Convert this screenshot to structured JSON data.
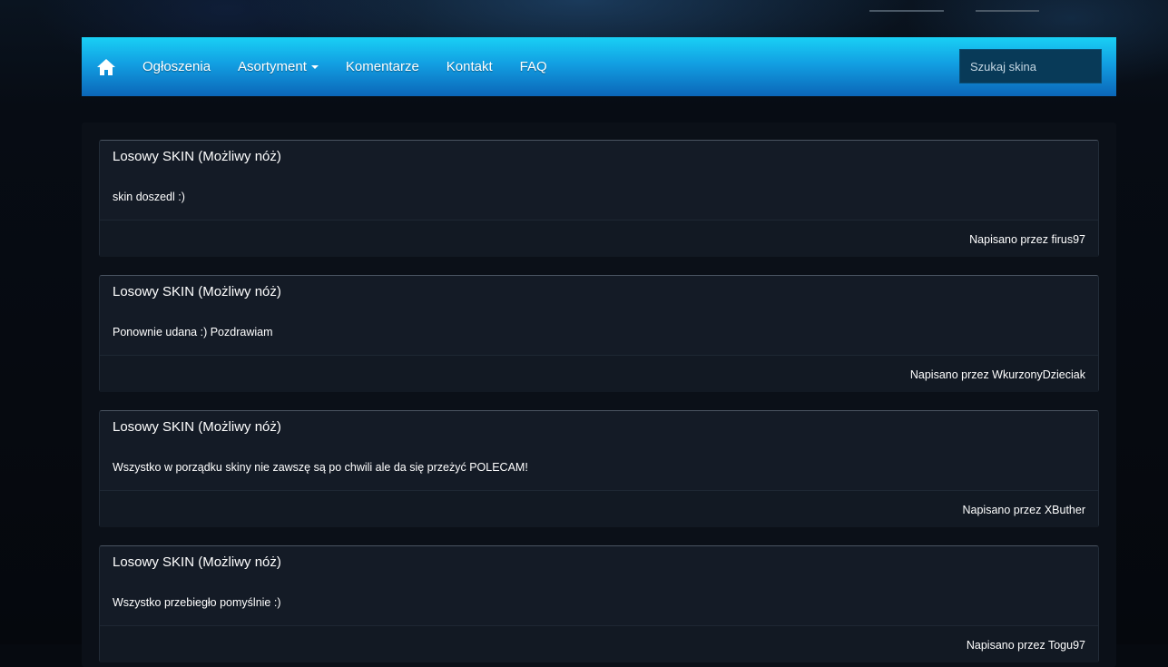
{
  "nav": {
    "home_icon": "home-icon",
    "links": {
      "announcements": "Ogłoszenia",
      "assortment": "Asortyment",
      "comments": "Komentarze",
      "contact": "Kontakt",
      "faq": "FAQ"
    },
    "search_placeholder": "Szukaj skina"
  },
  "colors": {
    "navbar_top": "#19d0f5",
    "navbar_bottom": "#0b66b8",
    "card_bg": "#141b26",
    "page_bg": "#060a10"
  },
  "comments": [
    {
      "title": "Losowy SKIN (Możliwy nóż)",
      "body": "skin doszedl :)",
      "author": "Napisano przez firus97"
    },
    {
      "title": "Losowy SKIN (Możliwy nóż)",
      "body": "Ponownie udana :) Pozdrawiam",
      "author": "Napisano przez WkurzonyDzieciak"
    },
    {
      "title": "Losowy SKIN (Możliwy nóż)",
      "body": "Wszystko w porządku skiny nie zawszę są po chwili ale da się przeżyć POLECAM!",
      "author": "Napisano przez XButher"
    },
    {
      "title": "Losowy SKIN (Możliwy nóż)",
      "body": "Wszystko przebiegło pomyślnie :)",
      "author": "Napisano przez Togu97"
    }
  ]
}
